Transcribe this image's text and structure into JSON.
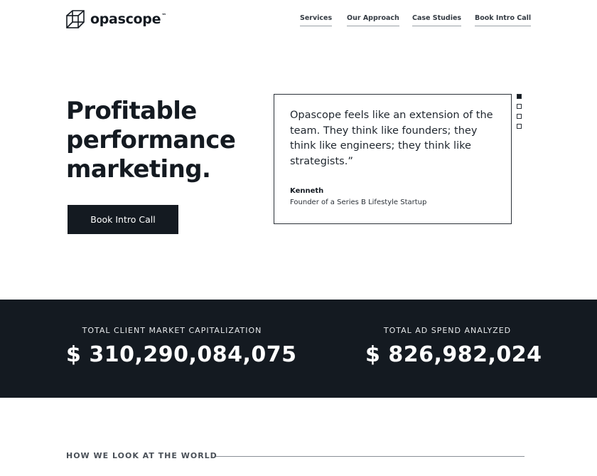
{
  "header": {
    "logo_text": "opascope",
    "logo_tm": "™",
    "nav": [
      "Services",
      "Our Approach",
      "Case Studies",
      "Book Intro Call"
    ]
  },
  "hero": {
    "title_lines": [
      "Profitable",
      "performance",
      "marketing."
    ],
    "cta_label": "Book Intro Call"
  },
  "testimonial": {
    "quote": "Opascope feels like an extension of the team. They think like founders; they think like engineers; they think like strategists.”",
    "author_name": "Kenneth",
    "author_role": "Founder of a Series B Lifestyle Startup",
    "active_slide": 1,
    "slide_count": 4
  },
  "stats": [
    {
      "label": "TOTAL CLIENT MARKET CAPITALIZATION",
      "value": "$ 310,290,084,075"
    },
    {
      "label": "TOTAL AD SPEND ANALYZED",
      "value": "$ 826,982,024"
    }
  ],
  "section": {
    "heading": "HOW WE LOOK AT THE WORLD"
  },
  "colors": {
    "dark": "#141a21",
    "background": "#ffffff"
  },
  "icons": {
    "logo": "cube-logo-icon"
  }
}
